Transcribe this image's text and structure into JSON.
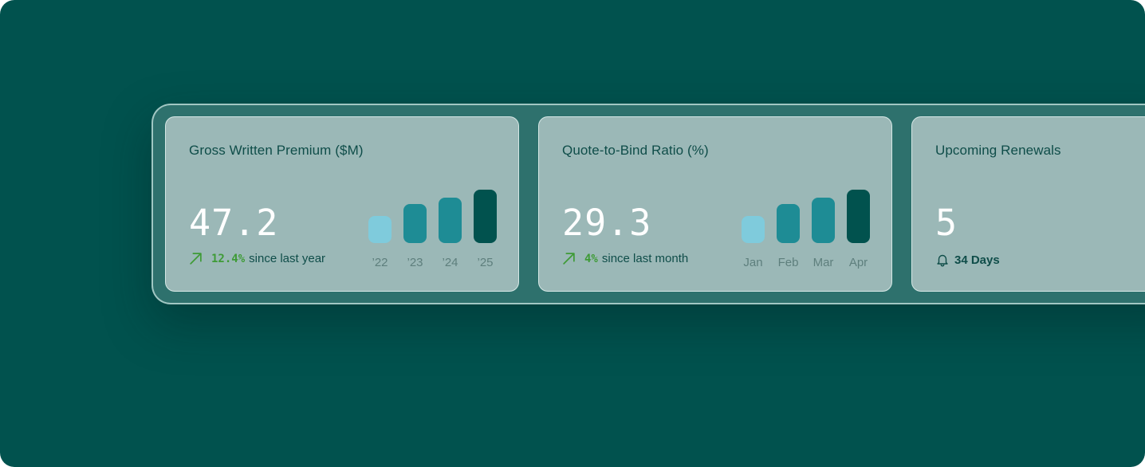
{
  "cards": [
    {
      "title": "Gross Written Premium ($M)",
      "value": "47.2",
      "delta_value": "12.4%",
      "delta_text": "since last year"
    },
    {
      "title": "Quote-to-Bind Ratio (%)",
      "value": "29.3",
      "delta_value": "4%",
      "delta_text": "since last month"
    },
    {
      "title": "Upcoming Renewals",
      "value": "5",
      "badge_text": "34 Days",
      "badge_icon": "bell-icon"
    }
  ],
  "colors": {
    "background": "#01524e",
    "card": "#9bb8b7",
    "positive": "#3e9b36",
    "bar_light": "#7fcbdc",
    "bar_mid": "#1e8c95",
    "bar_dark": "#01524e"
  },
  "chart_data": [
    {
      "type": "bar",
      "categories": [
        "’22",
        "’23",
        "’24",
        "’25"
      ],
      "values": [
        35,
        50,
        59,
        69
      ],
      "ylim": [
        0,
        70
      ],
      "grid": false
    },
    {
      "type": "bar",
      "categories": [
        "Jan",
        "Feb",
        "Mar",
        "Apr"
      ],
      "values": [
        35,
        50,
        59,
        69
      ],
      "ylim": [
        0,
        70
      ],
      "grid": false
    }
  ]
}
